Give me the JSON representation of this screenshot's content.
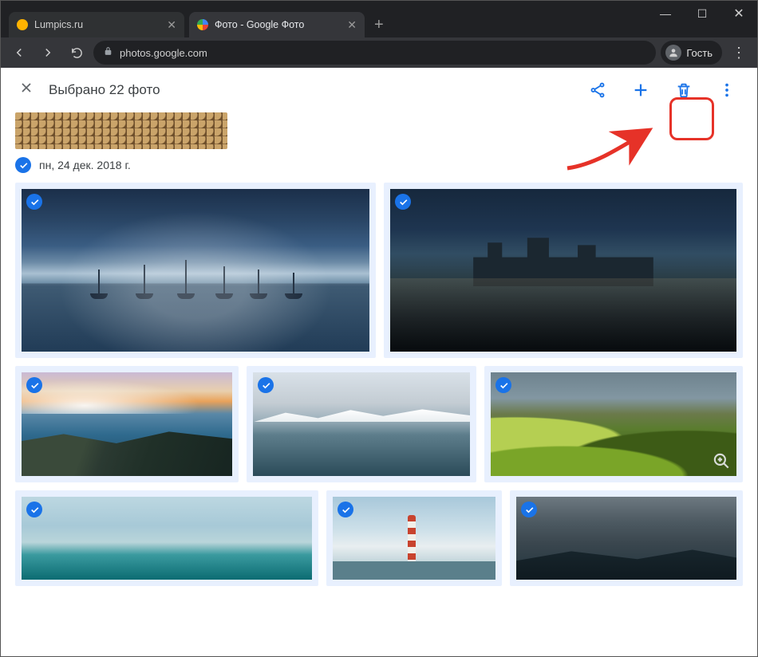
{
  "window": {
    "minimize": "—",
    "maximize": "☐",
    "close": "✕"
  },
  "tabs": [
    {
      "title": "Lumpics.ru",
      "close": "✕"
    },
    {
      "title": "Фото - Google Фото",
      "close": "✕"
    }
  ],
  "newtab": "+",
  "nav": {
    "back": "←",
    "forward": "→",
    "reload": "⟳"
  },
  "address": {
    "lock": "🔒",
    "url": "photos.google.com"
  },
  "profile": {
    "label": "Гость"
  },
  "browser_menu": "⋮",
  "toolbar": {
    "close": "✕",
    "title": "Выбрано 22 фото",
    "more": "⋮"
  },
  "date_group": {
    "label": "пн, 24 дек. 2018 г."
  }
}
